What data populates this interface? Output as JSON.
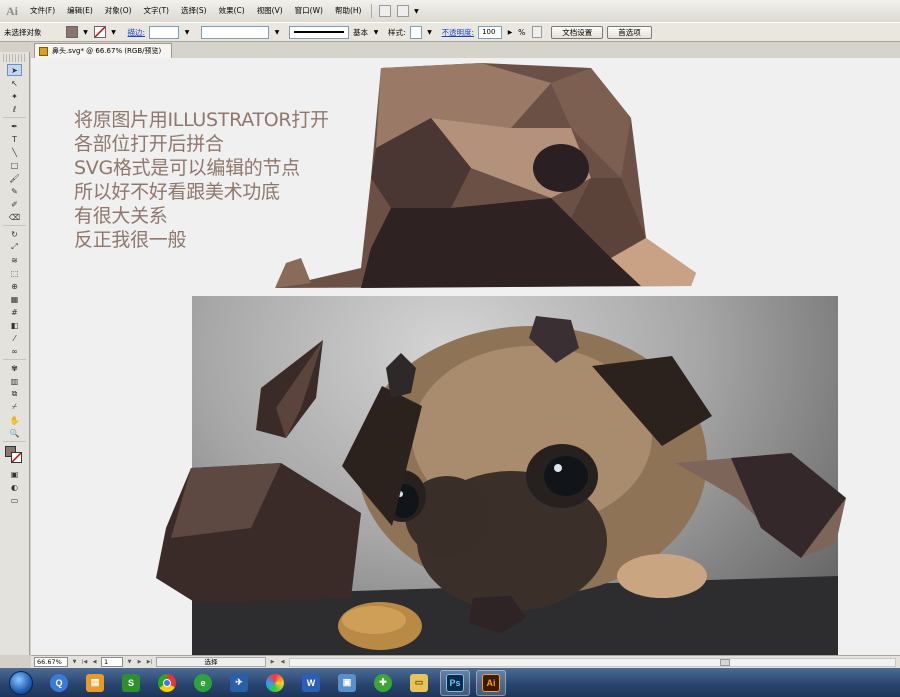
{
  "app": {
    "logo": "Ai"
  },
  "menu": [
    "文件(F)",
    "编辑(E)",
    "对象(O)",
    "文字(T)",
    "选择(S)",
    "效果(C)",
    "视图(V)",
    "窗口(W)",
    "帮助(H)"
  ],
  "control_bar": {
    "selection": "未选择对象",
    "stroke_link": "描边:",
    "stroke_style_label": "基本",
    "style_label": "样式:",
    "opacity_link": "不透明度:",
    "opacity_value": "100",
    "opacity_unit": "%",
    "doc_setup_button": "文档设置",
    "preferences_button": "首选项",
    "colors": {
      "fill": "#8a766c",
      "stroke_none": "#ffffff"
    }
  },
  "document_tab": {
    "title": "鼻头.svg* @ 66.67% (RGB/预览)"
  },
  "canvas": {
    "note_lines": [
      "将原图片用ILLUSTRATOR打开",
      "各部位打开后拼合",
      "SVG格式是可以编辑的节点",
      "所以好不好看跟美术功底",
      "有很大关系",
      "反正我很一般"
    ],
    "colors": {
      "note_text": "#8f776c",
      "poly_dark": "#3a2a27",
      "poly_mid": "#6b5045",
      "poly_light": "#b4917a"
    }
  },
  "status_bar": {
    "zoom": "66.67%",
    "artboard": "1",
    "status": "选择"
  },
  "taskbar": {
    "apps": [
      {
        "icon": "windows-start-icon"
      },
      {
        "icon": "qq-app-icon"
      },
      {
        "icon": "file-explorer-green-icon"
      },
      {
        "icon": "wps-s-icon",
        "label": "S"
      },
      {
        "icon": "chrome-icon"
      },
      {
        "icon": "ie-icon"
      },
      {
        "icon": "bird-app-icon"
      },
      {
        "icon": "colorful-ball-icon"
      },
      {
        "icon": "word-icon",
        "label": "W"
      },
      {
        "icon": "remote-desktop-icon"
      },
      {
        "icon": "green-plus-icon"
      },
      {
        "icon": "folder-icon"
      },
      {
        "icon": "photoshop-icon",
        "label": "Ps"
      },
      {
        "icon": "illustrator-icon",
        "label": "Ai"
      }
    ]
  }
}
